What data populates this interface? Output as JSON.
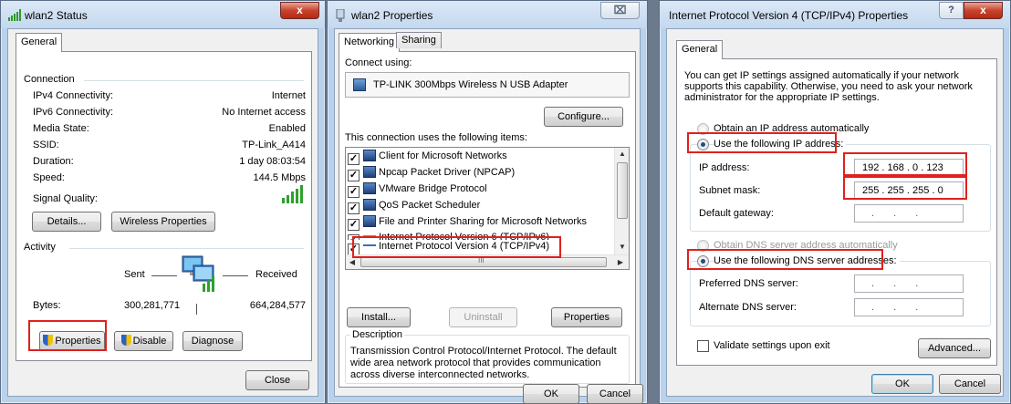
{
  "status_window": {
    "title": "wlan2 Status",
    "tab": "General",
    "connection_header": "Connection",
    "rows": [
      {
        "label": "IPv4 Connectivity:",
        "value": "Internet"
      },
      {
        "label": "IPv6 Connectivity:",
        "value": "No Internet access"
      },
      {
        "label": "Media State:",
        "value": "Enabled"
      },
      {
        "label": "SSID:",
        "value": "TP-Link_A414"
      },
      {
        "label": "Duration:",
        "value": "1 day 08:03:54"
      },
      {
        "label": "Speed:",
        "value": "144.5 Mbps"
      }
    ],
    "signal_label": "Signal Quality:",
    "details_button": "Details...",
    "wireless_button": "Wireless Properties",
    "activity_header": "Activity",
    "sent_label": "Sent",
    "received_label": "Received",
    "bytes_label": "Bytes:",
    "bytes_sent": "300,281,771",
    "bytes_received": "664,284,577",
    "properties_button": "Properties",
    "disable_button": "Disable",
    "diagnose_button": "Diagnose",
    "close_button": "Close",
    "close_glyph": "x"
  },
  "props_window": {
    "title": "wlan2 Properties",
    "close_glyph": "⌧",
    "tabs": [
      "Networking",
      "Sharing"
    ],
    "connect_using_label": "Connect using:",
    "adapter": "TP-LINK 300Mbps Wireless N USB Adapter",
    "configure_button": "Configure...",
    "items_label": "This connection uses the following items:",
    "items": [
      {
        "label": "Client for Microsoft Networks",
        "checked": true
      },
      {
        "label": "Npcap Packet Driver (NPCAP)",
        "checked": true
      },
      {
        "label": "VMware Bridge Protocol",
        "checked": true
      },
      {
        "label": "QoS Packet Scheduler",
        "checked": true
      },
      {
        "label": "File and Printer Sharing for Microsoft Networks",
        "checked": true
      },
      {
        "label": "Internet Protocol Version 6 (TCP/IPv6)",
        "checked": true
      },
      {
        "label": "Internet Protocol Version 4 (TCP/IPv4)",
        "checked": true
      }
    ],
    "hscroll_glyph": "III",
    "install_button": "Install...",
    "uninstall_button": "Uninstall",
    "properties_button": "Properties",
    "description_header": "Description",
    "description_text": "Transmission Control Protocol/Internet Protocol. The default wide area network protocol that provides communication across diverse interconnected networks.",
    "ok_button": "OK",
    "cancel_button": "Cancel"
  },
  "ipv4_window": {
    "title": "Internet Protocol Version 4 (TCP/IPv4) Properties",
    "help_glyph": "?",
    "close_glyph": "x",
    "tab": "General",
    "intro": "You can get IP settings assigned automatically if your network supports this capability. Otherwise, you need to ask your network administrator for the appropriate IP settings.",
    "obtain_ip_auto": "Obtain an IP address automatically",
    "use_following_ip": "Use the following IP address:",
    "ip_address_label": "IP address:",
    "ip_address": "192 . 168 . 0 . 123",
    "subnet_label": "Subnet mask:",
    "subnet": "255 . 255 . 255 . 0",
    "gateway_label": "Default gateway:",
    "empty_ip": ". . .",
    "obtain_dns_auto": "Obtain DNS server address automatically",
    "use_following_dns": "Use the following DNS server addresses:",
    "preferred_dns_label": "Preferred DNS server:",
    "alternate_dns_label": "Alternate DNS server:",
    "validate_label": "Validate settings upon exit",
    "advanced_button": "Advanced...",
    "ok_button": "OK",
    "cancel_button": "Cancel"
  },
  "colors": {
    "highlight_box": "#e0201f",
    "window_frame": "#b9d1ea",
    "dialog_face": "#f0f0f0"
  }
}
